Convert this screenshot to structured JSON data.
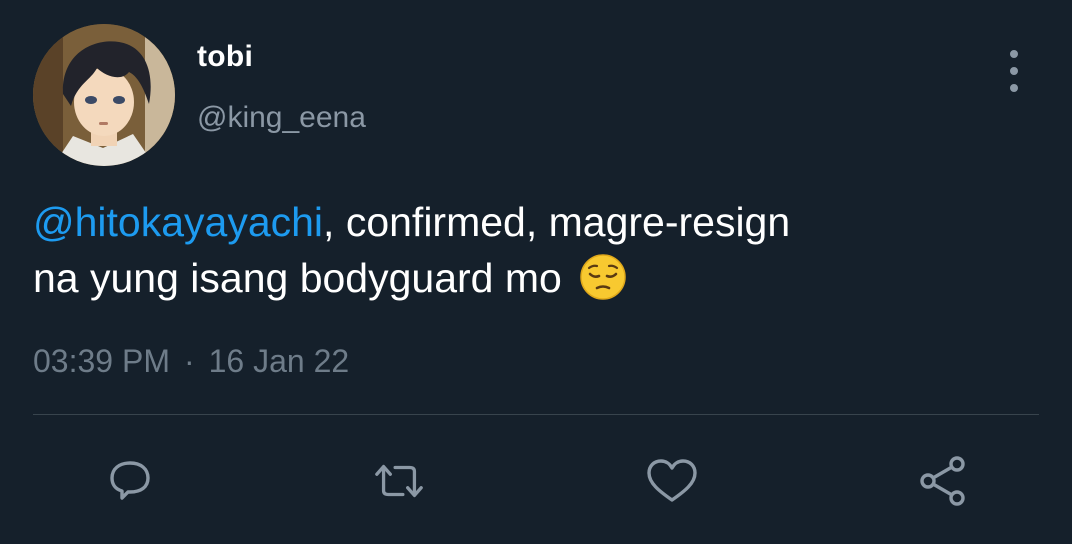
{
  "tweet": {
    "author_name": "tobi",
    "author_handle": "@king_eena",
    "mention": "@hitokayayachi",
    "text_line1_rest": ", confirmed, magre-resign",
    "text_line2": "na yung isang bodyguard mo",
    "emoji": "pensive-face-emoji",
    "time": "03:39 PM",
    "separator": "·",
    "date": "16 Jan 22"
  },
  "actions": [
    {
      "name": "reply",
      "icon": "reply-icon"
    },
    {
      "name": "retweet",
      "icon": "retweet-icon"
    },
    {
      "name": "like",
      "icon": "heart-icon"
    },
    {
      "name": "share",
      "icon": "share-icon"
    }
  ],
  "colors": {
    "background": "#15202b",
    "text": "#ffffff",
    "secondary_text": "#8b98a5",
    "mention": "#1d9bf0",
    "divider": "#38444d",
    "icon": "#8b98a5"
  }
}
